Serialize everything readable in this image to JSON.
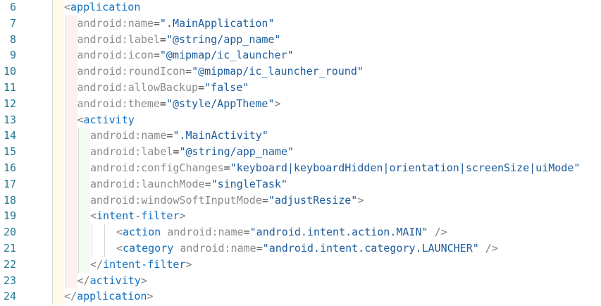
{
  "editor": {
    "language": "xml",
    "lines": [
      {
        "num": "6",
        "indent": 1,
        "parts": [
          [
            "punct",
            "<"
          ],
          [
            "tag",
            "application"
          ]
        ]
      },
      {
        "num": "7",
        "indent": 2,
        "parts": [
          [
            "attr",
            "android:name"
          ],
          [
            "eq",
            "="
          ],
          [
            "str",
            "\".MainApplication\""
          ]
        ]
      },
      {
        "num": "8",
        "indent": 2,
        "parts": [
          [
            "attr",
            "android:label"
          ],
          [
            "eq",
            "="
          ],
          [
            "str",
            "\"@string/app_name\""
          ]
        ]
      },
      {
        "num": "9",
        "indent": 2,
        "parts": [
          [
            "attr",
            "android:icon"
          ],
          [
            "eq",
            "="
          ],
          [
            "str",
            "\"@mipmap/ic_launcher\""
          ]
        ]
      },
      {
        "num": "10",
        "indent": 2,
        "parts": [
          [
            "attr",
            "android:roundIcon"
          ],
          [
            "eq",
            "="
          ],
          [
            "str",
            "\"@mipmap/ic_launcher_round\""
          ]
        ]
      },
      {
        "num": "11",
        "indent": 2,
        "parts": [
          [
            "attr",
            "android:allowBackup"
          ],
          [
            "eq",
            "="
          ],
          [
            "str",
            "\"false\""
          ]
        ]
      },
      {
        "num": "12",
        "indent": 2,
        "parts": [
          [
            "attr",
            "android:theme"
          ],
          [
            "eq",
            "="
          ],
          [
            "str",
            "\"@style/AppTheme\""
          ],
          [
            "punct",
            ">"
          ]
        ]
      },
      {
        "num": "13",
        "indent": 2,
        "parts": [
          [
            "punct",
            "<"
          ],
          [
            "tag",
            "activity"
          ]
        ]
      },
      {
        "num": "14",
        "indent": 3,
        "parts": [
          [
            "attr",
            "android:name"
          ],
          [
            "eq",
            "="
          ],
          [
            "str",
            "\".MainActivity\""
          ]
        ]
      },
      {
        "num": "15",
        "indent": 3,
        "parts": [
          [
            "attr",
            "android:label"
          ],
          [
            "eq",
            "="
          ],
          [
            "str",
            "\"@string/app_name\""
          ]
        ]
      },
      {
        "num": "16",
        "indent": 3,
        "parts": [
          [
            "attr",
            "android:configChanges"
          ],
          [
            "eq",
            "="
          ],
          [
            "str",
            "\"keyboard|keyboardHidden|orientation|screenSize|uiMode\""
          ]
        ]
      },
      {
        "num": "17",
        "indent": 3,
        "parts": [
          [
            "attr",
            "android:launchMode"
          ],
          [
            "eq",
            "="
          ],
          [
            "str",
            "\"singleTask\""
          ]
        ]
      },
      {
        "num": "18",
        "indent": 3,
        "parts": [
          [
            "attr",
            "android:windowSoftInputMode"
          ],
          [
            "eq",
            "="
          ],
          [
            "str",
            "\"adjustResize\""
          ],
          [
            "punct",
            ">"
          ]
        ]
      },
      {
        "num": "19",
        "indent": 3,
        "parts": [
          [
            "punct",
            "<"
          ],
          [
            "tag",
            "intent-filter"
          ],
          [
            "punct",
            ">"
          ]
        ]
      },
      {
        "num": "20",
        "indent": 5,
        "parts": [
          [
            "punct",
            "<"
          ],
          [
            "tag",
            "action"
          ],
          [
            "plain",
            " "
          ],
          [
            "attr",
            "android:name"
          ],
          [
            "eq",
            "="
          ],
          [
            "str",
            "\"android.intent.action.MAIN\""
          ],
          [
            "plain",
            " "
          ],
          [
            "punct",
            "/>"
          ]
        ]
      },
      {
        "num": "21",
        "indent": 5,
        "parts": [
          [
            "punct",
            "<"
          ],
          [
            "tag",
            "category"
          ],
          [
            "plain",
            " "
          ],
          [
            "attr",
            "android:name"
          ],
          [
            "eq",
            "="
          ],
          [
            "str",
            "\"android.intent.category.LAUNCHER\""
          ],
          [
            "plain",
            " "
          ],
          [
            "punct",
            "/>"
          ]
        ]
      },
      {
        "num": "22",
        "indent": 3,
        "parts": [
          [
            "punct",
            "</"
          ],
          [
            "tag",
            "intent-filter"
          ],
          [
            "punct",
            ">"
          ]
        ]
      },
      {
        "num": "23",
        "indent": 2,
        "parts": [
          [
            "punct",
            "</"
          ],
          [
            "tag",
            "activity"
          ],
          [
            "punct",
            ">"
          ]
        ]
      },
      {
        "num": "24",
        "indent": 1,
        "parts": [
          [
            "punct",
            "</"
          ],
          [
            "tag",
            "application"
          ],
          [
            "punct",
            ">"
          ]
        ]
      }
    ]
  }
}
